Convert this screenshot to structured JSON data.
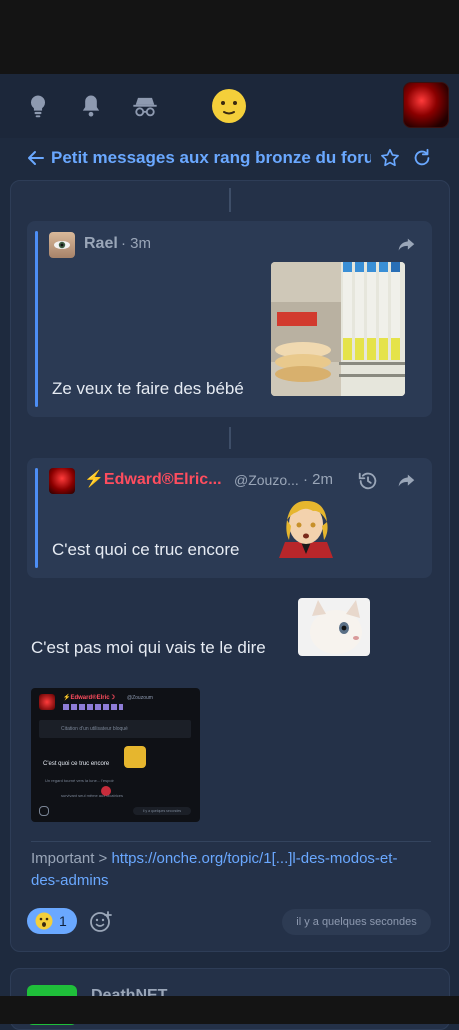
{
  "header": {
    "title": "Petit messages aux rang bronze du forum"
  },
  "messages": [
    {
      "author": "Rael",
      "time": "3m",
      "text": "Ze veux te faire des bébé"
    },
    {
      "author": "⚡Edward®Elric...",
      "handle": "@Zouzo...",
      "time": "2m",
      "text": "C'est quoi ce truc encore"
    }
  ],
  "reply": {
    "text": "C'est pas moi qui vais te le dire"
  },
  "screenshot": {
    "author": "⚡Edward®Elric☽",
    "handle": "@Zouzoum",
    "quote_placeholder": "Citation d'un utilisateur bloqué",
    "text": "C'est quoi ce truc encore",
    "line1": "Un regard tourné vers la lune... l'espoir",
    "line2": "survivant seul même aux cicatrices",
    "time": "il y a quelques secondes"
  },
  "important": {
    "label": "Important > ",
    "link": "https://onche.org/topic/1[...]l-des-modos-et-des-admins"
  },
  "reactions": {
    "count": "1"
  },
  "timestamp": "il y a quelques secondes",
  "next_post": {
    "author": "DeathNET"
  },
  "colors": {
    "accent": "#6aa8ff",
    "edward": "#ff4d5e",
    "background": "#1e2a3e"
  }
}
